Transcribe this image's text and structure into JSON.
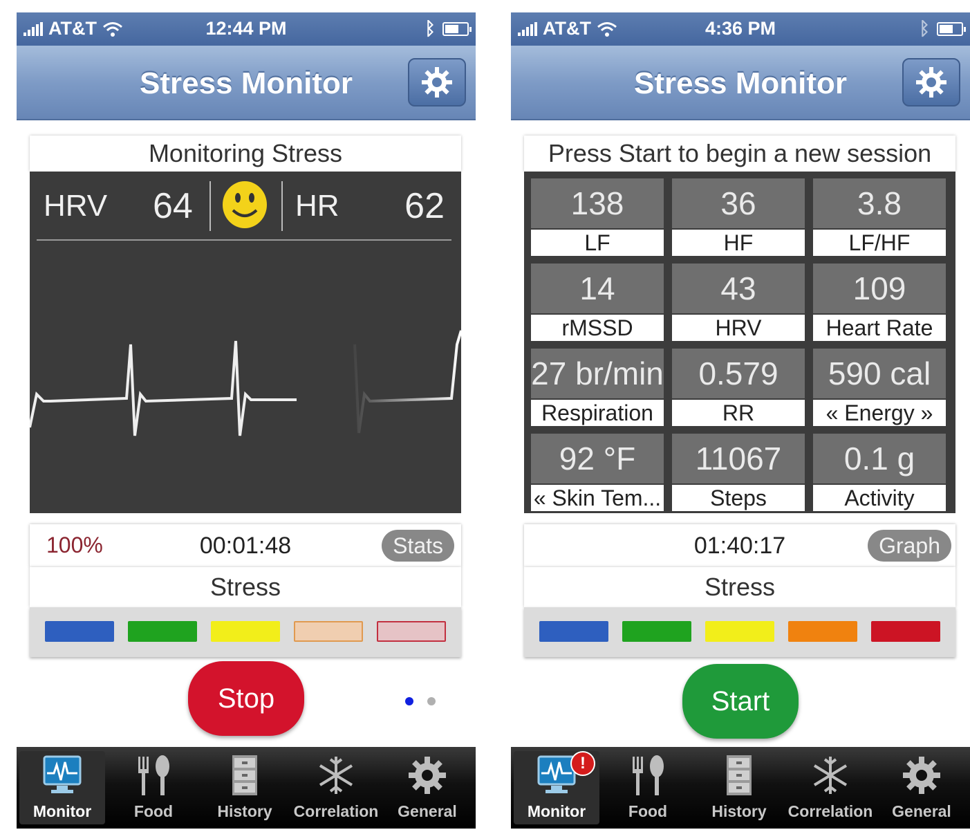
{
  "left_screen": {
    "status_bar": {
      "carrier": "AT&T",
      "time": "12:44 PM"
    },
    "nav_title": "Stress Monitor",
    "card_title": "Monitoring Stress",
    "hrv_label": "HRV",
    "hrv_value": "64",
    "hr_label": "HR",
    "hr_value": "62",
    "battery_percent": "100%",
    "elapsed": "00:01:48",
    "stats_button": "Stats",
    "stress_label": "Stress",
    "stop_button": "Stop",
    "page_indicator": {
      "pages": 2,
      "current": 1
    }
  },
  "right_screen": {
    "status_bar": {
      "carrier": "AT&T",
      "time": "4:36 PM"
    },
    "nav_title": "Stress Monitor",
    "card_title": "Press Start to begin a new session",
    "stats": [
      {
        "value": "138",
        "label": "LF"
      },
      {
        "value": "36",
        "label": "HF"
      },
      {
        "value": "3.8",
        "label": "LF/HF"
      },
      {
        "value": "14",
        "label": "rMSSD"
      },
      {
        "value": "43",
        "label": "HRV"
      },
      {
        "value": "109",
        "label": "Heart Rate"
      },
      {
        "value": "27 br/min",
        "label": "Respiration"
      },
      {
        "value": "0.579",
        "label": "RR"
      },
      {
        "value": "590 cal",
        "label": "« Energy »"
      },
      {
        "value": "92 °F",
        "label": "« Skin Tem..."
      },
      {
        "value": "11067",
        "label": "Steps"
      },
      {
        "value": "0.1 g",
        "label": "Activity"
      }
    ],
    "elapsed": "01:40:17",
    "graph_button": "Graph",
    "stress_label": "Stress",
    "start_button": "Start",
    "monitor_badge": "!"
  },
  "tabs": [
    {
      "label": "Monitor",
      "icon": "monitor-icon"
    },
    {
      "label": "Food",
      "icon": "fork-spoon-icon"
    },
    {
      "label": "History",
      "icon": "cabinet-icon"
    },
    {
      "label": "Correlation",
      "icon": "snowflake-icon"
    },
    {
      "label": "General",
      "icon": "gear-icon"
    }
  ],
  "stress_colors_active": [
    "#2e5fbf",
    "#1fa31f",
    "#f2ee1a",
    "#f0820f",
    "#cc1424"
  ],
  "stress_colors_left": [
    "#2e5fbf",
    "#1fa31f",
    "#f2ee1a",
    "#f0ceb0",
    "#e6c3c6"
  ],
  "colors": {
    "stop": "#d3132c",
    "start": "#1f9a3a",
    "nav": "#7f9cc7"
  }
}
